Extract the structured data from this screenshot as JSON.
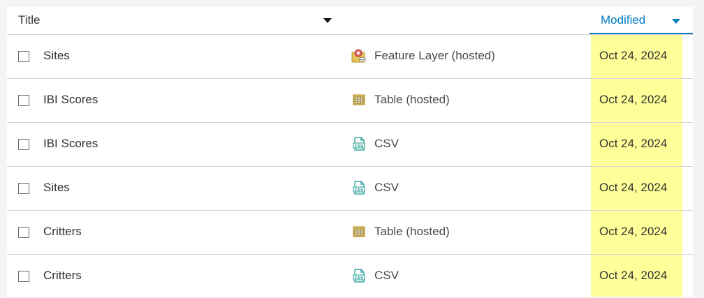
{
  "header": {
    "title_label": "Title",
    "modified_label": "Modified"
  },
  "highlight_color": "#ffff99",
  "accent_color": "#007ac2",
  "rows": [
    {
      "name": "Sites",
      "type": "Feature Layer (hosted)",
      "icon": "feature-layer-icon",
      "modified": "Oct 24, 2024"
    },
    {
      "name": "IBI Scores",
      "type": "Table (hosted)",
      "icon": "table-icon",
      "modified": "Oct 24, 2024"
    },
    {
      "name": "IBI Scores",
      "type": "CSV",
      "icon": "csv-icon",
      "modified": "Oct 24, 2024"
    },
    {
      "name": "Sites",
      "type": "CSV",
      "icon": "csv-icon",
      "modified": "Oct 24, 2024"
    },
    {
      "name": "Critters",
      "type": "Table (hosted)",
      "icon": "table-icon",
      "modified": "Oct 24, 2024"
    },
    {
      "name": "Critters",
      "type": "CSV",
      "icon": "csv-icon",
      "modified": "Oct 24, 2024"
    }
  ]
}
